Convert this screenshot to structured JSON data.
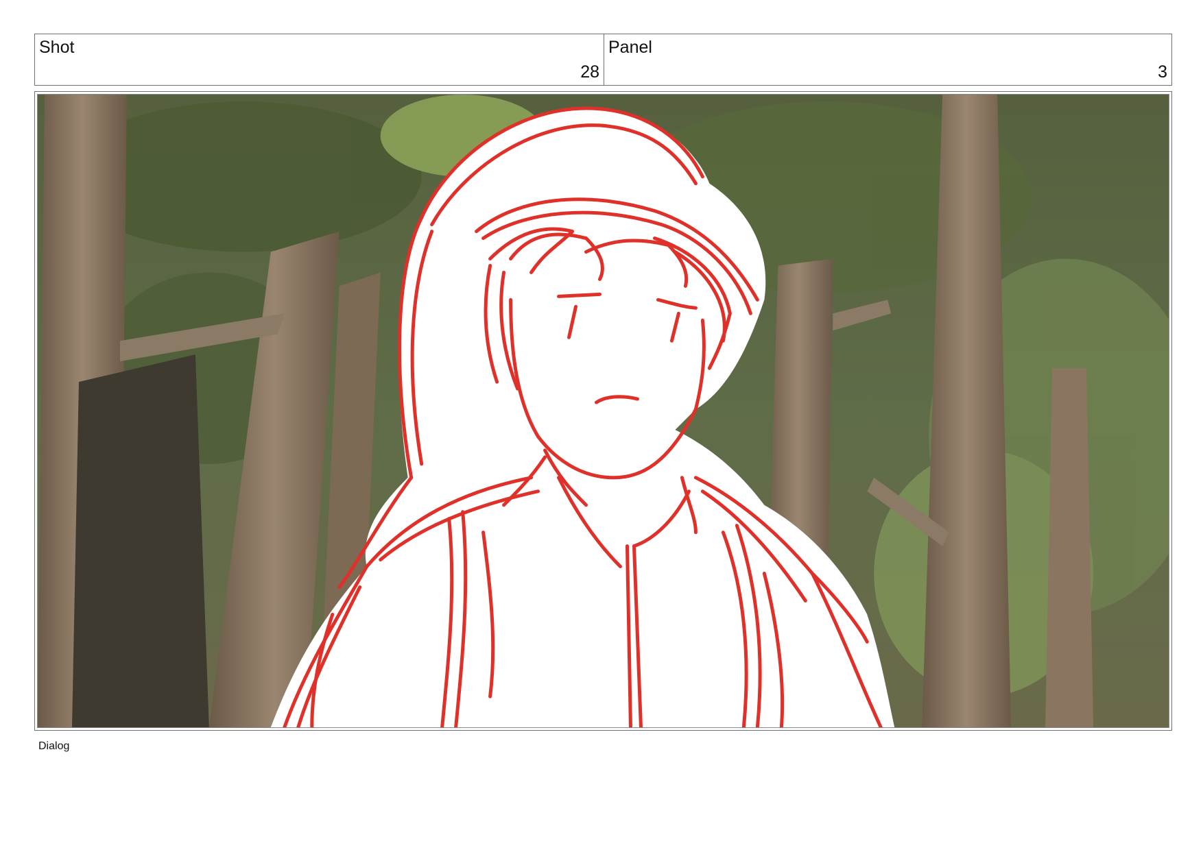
{
  "header": {
    "shot_label": "Shot",
    "shot_number": "28",
    "panel_label": "Panel",
    "panel_number": "3"
  },
  "frame": {
    "content": "storyboard-sketch",
    "sketch_color": "#e0302a",
    "background_colors": [
      "#5e6b47",
      "#7a6a55",
      "#a0a97a"
    ]
  },
  "dialog": {
    "label": "Dialog"
  }
}
